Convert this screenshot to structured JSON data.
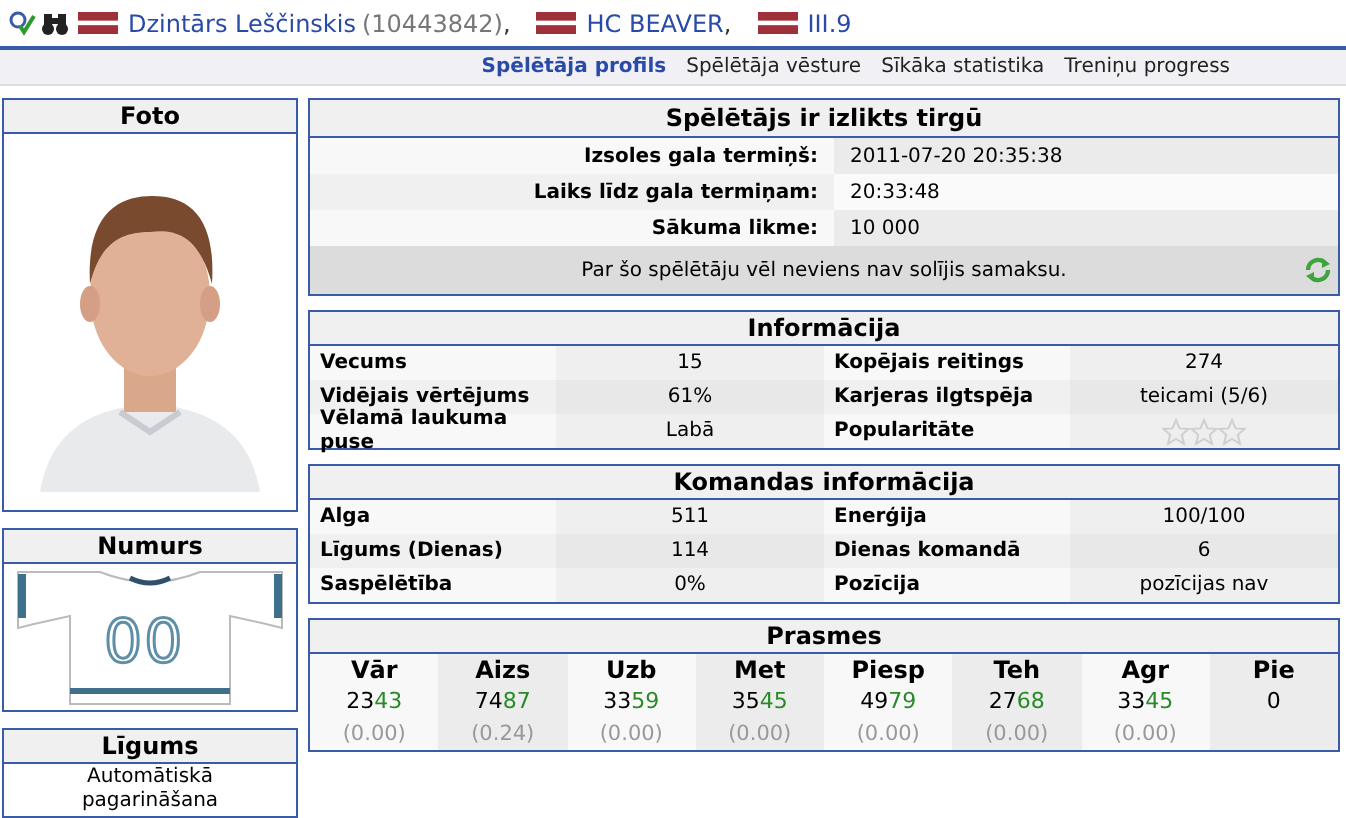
{
  "top_bar": {
    "player_name": "Dzintārs Leščinskis",
    "player_id": "(10443842)",
    "separator": ",",
    "team": "HC BEAVER",
    "team_separator": ",",
    "league": "III.9"
  },
  "tabs": [
    {
      "label": "Spēlētāja profils",
      "selected": true
    },
    {
      "label": "Spēlētāja vēsture",
      "selected": false
    },
    {
      "label": "Sīkāka statistika",
      "selected": false
    },
    {
      "label": "Treniņu progress",
      "selected": false
    }
  ],
  "photo_card": {
    "title": "Foto"
  },
  "number_card": {
    "title": "Numurs",
    "number": "00"
  },
  "contract_card": {
    "title": "Līgums",
    "text": "Automātiskā pagarināšana"
  },
  "market": {
    "title": "Spēlētājs ir izlikts tirgū",
    "rows": [
      {
        "label": "Izsoles gala termiņš:",
        "value": "2011-07-20 20:35:38"
      },
      {
        "label": "Laiks līdz gala termiņam:",
        "value": "20:33:48"
      },
      {
        "label": "Sākuma likme:",
        "value": "10 000"
      }
    ],
    "note": "Par šo spēlētāju vēl neviens nav solījis samaksu."
  },
  "info": {
    "title": "Informācija",
    "rows": [
      [
        {
          "label": "Vecums",
          "value": "15"
        },
        {
          "label": "Kopējais reitings",
          "value": "274"
        }
      ],
      [
        {
          "label": "Vidējais vērtējums",
          "value": "61%"
        },
        {
          "label": "Karjeras ilgtspēja",
          "value": "teicami (5/6)"
        }
      ],
      [
        {
          "label": "Vēlamā laukuma puse",
          "value": "Labā"
        },
        {
          "label": "Popularitāte",
          "stars": 0
        }
      ]
    ]
  },
  "team_info": {
    "title": "Komandas informācija",
    "rows": [
      [
        {
          "label": "Alga",
          "value": "511"
        },
        {
          "label": "Enerģija",
          "value": "100/100"
        }
      ],
      [
        {
          "label": "Līgums (Dienas)",
          "value": "114"
        },
        {
          "label": "Dienas komandā",
          "value": "6"
        }
      ],
      [
        {
          "label": "Saspēlētība",
          "value": "0%"
        },
        {
          "label": "Pozīcija",
          "value": "pozīcijas nav"
        }
      ]
    ]
  },
  "skills": {
    "title": "Prasmes",
    "columns": [
      {
        "label": "Vār",
        "value": "23",
        "potential": "43",
        "change": "(0.00)"
      },
      {
        "label": "Aizs",
        "value": "74",
        "potential": "87",
        "change": "(0.24)"
      },
      {
        "label": "Uzb",
        "value": "33",
        "potential": "59",
        "change": "(0.00)"
      },
      {
        "label": "Met",
        "value": "35",
        "potential": "45",
        "change": "(0.00)"
      },
      {
        "label": "Piesp",
        "value": "49",
        "potential": "79",
        "change": "(0.00)"
      },
      {
        "label": "Teh",
        "value": "27",
        "potential": "68",
        "change": "(0.00)"
      },
      {
        "label": "Agr",
        "value": "33",
        "potential": "45",
        "change": "(0.00)"
      },
      {
        "label": "Pie",
        "value": "0"
      }
    ]
  }
}
